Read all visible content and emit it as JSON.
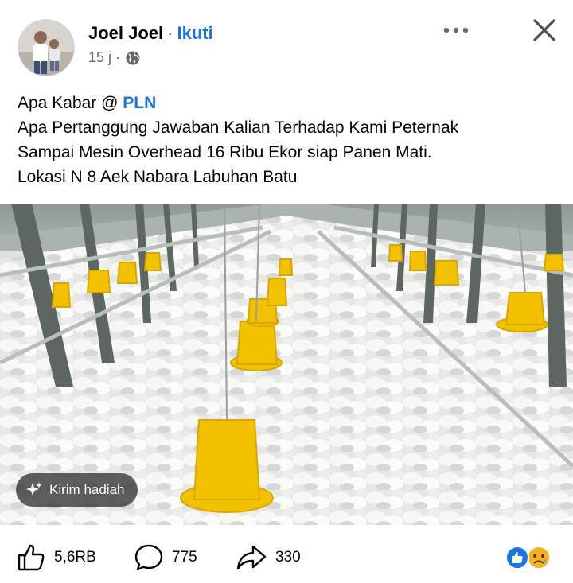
{
  "header": {
    "author_name": "Joel Joel",
    "separator": "·",
    "follow_label": "Ikuti",
    "timestamp": "15 j ·",
    "audience_icon": "globe-icon",
    "more_icon": "more-dots-icon",
    "close_icon": "close-icon"
  },
  "post": {
    "lines": [
      {
        "prefix": "Apa Kabar @ ",
        "mention": "PLN"
      },
      {
        "text": "Apa Pertanggung Jawaban Kalian Terhadap Kami Peternak"
      },
      {
        "text": "Sampai Mesin Overhead 16 Ribu Ekor siap Panen Mati."
      },
      {
        "text": "Lokasi N 8 Aek Nabara Labuhan Batu"
      }
    ]
  },
  "gift": {
    "label": "Kirim hadiah",
    "icon": "gift-sparkle-icon"
  },
  "actions": {
    "like_count": "5,6RB",
    "comment_count": "775",
    "share_count": "330",
    "like_icon": "thumbs-up-icon",
    "comment_icon": "comment-bubble-icon",
    "share_icon": "share-arrow-icon",
    "reactions": [
      "like-reaction-icon",
      "sad-reaction-icon"
    ]
  },
  "colors": {
    "accent": "#1b74e4",
    "secondary_text": "#65676b",
    "feeder_yellow": "#f2c200"
  }
}
